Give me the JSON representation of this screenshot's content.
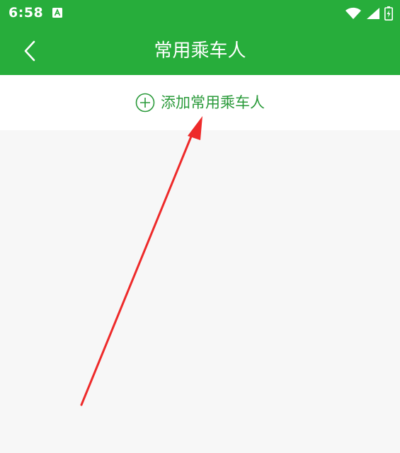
{
  "status_bar": {
    "time": "6:58",
    "notification_icon": "text-a-icon",
    "wifi_icon": "wifi-icon",
    "signal_icon": "signal-icon",
    "battery_icon": "battery-charging-icon"
  },
  "header": {
    "back_icon": "chevron-left-icon",
    "title": "常用乘车人"
  },
  "add_passenger": {
    "icon": "plus-circle-icon",
    "label": "添加常用乘车人"
  },
  "annotation": {
    "arrow_icon": "red-arrow",
    "color": "#ee2a2a"
  },
  "colors": {
    "brand_green": "#27ad3b",
    "accent_green": "#2a9a3a",
    "background": "#f7f7f7"
  }
}
